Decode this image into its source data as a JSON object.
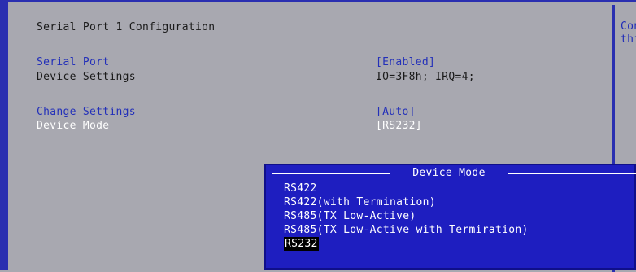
{
  "page": {
    "title": "Serial Port 1 Configuration"
  },
  "settings": [
    {
      "label": "Serial Port",
      "value": "[Enabled]"
    },
    {
      "label": "Device Settings",
      "value": "IO=3F8h; IRQ=4;"
    },
    {
      "label": "Change Settings",
      "value": "[Auto]"
    },
    {
      "label": "Device Mode",
      "value": "[RS232]"
    }
  ],
  "help": {
    "line1": "Con",
    "line2": "thi"
  },
  "popup": {
    "title": "Device Mode",
    "options": [
      "RS422",
      "RS422(with Termination)",
      "RS485(TX Low-Active)",
      "RS485(TX Low-Active with Termiration)",
      "RS232"
    ],
    "selected_option": "RS232"
  },
  "colors": {
    "frame_blue": "#2a2fb0",
    "background_gray": "#a8a8b0",
    "label_blue": "#2330b9",
    "popup_blue": "#1e1ec0",
    "highlight_black": "#000000"
  }
}
